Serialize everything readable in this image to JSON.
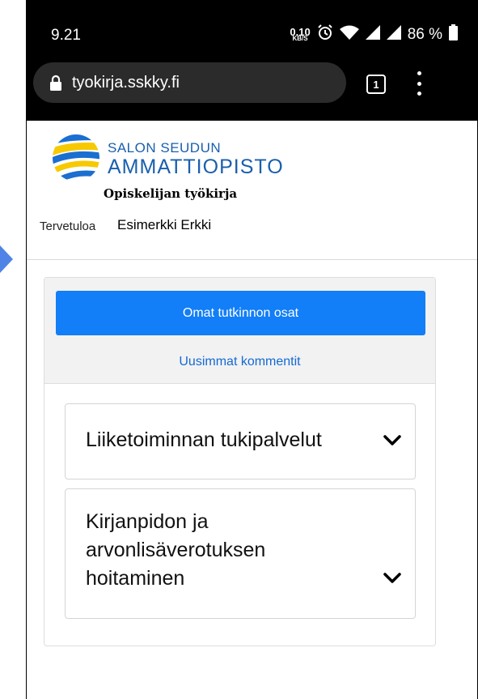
{
  "status_bar": {
    "time": "9.21",
    "net_speed_value": "0.10",
    "net_speed_unit": "KB/S",
    "battery": "86 %"
  },
  "browser": {
    "url": "tyokirja.sskky.fi",
    "tab_count": "1"
  },
  "header": {
    "logo_line1": "SALON SEUDUN",
    "logo_line2": "AMMATTIOPISTO",
    "app_subtitle": "Opiskelijan työkirja",
    "welcome_label": "Tervetuloa",
    "user_name": "Esimerkki Erkki"
  },
  "card": {
    "primary_button": "Omat tutkinnon osat",
    "comments_link": "Uusimmat kommentit",
    "items": [
      {
        "title": "Liiketoiminnan tukipalvelut"
      },
      {
        "title": "Kirjanpidon ja arvonlisäverotuksen hoitaminen"
      }
    ]
  },
  "colors": {
    "primary": "#127ef7",
    "link": "#1469d3",
    "brand": "#1a5fae",
    "logo_yellow": "#f7c900",
    "logo_blue": "#1a6fd0",
    "pointer": "#4f84e6"
  }
}
